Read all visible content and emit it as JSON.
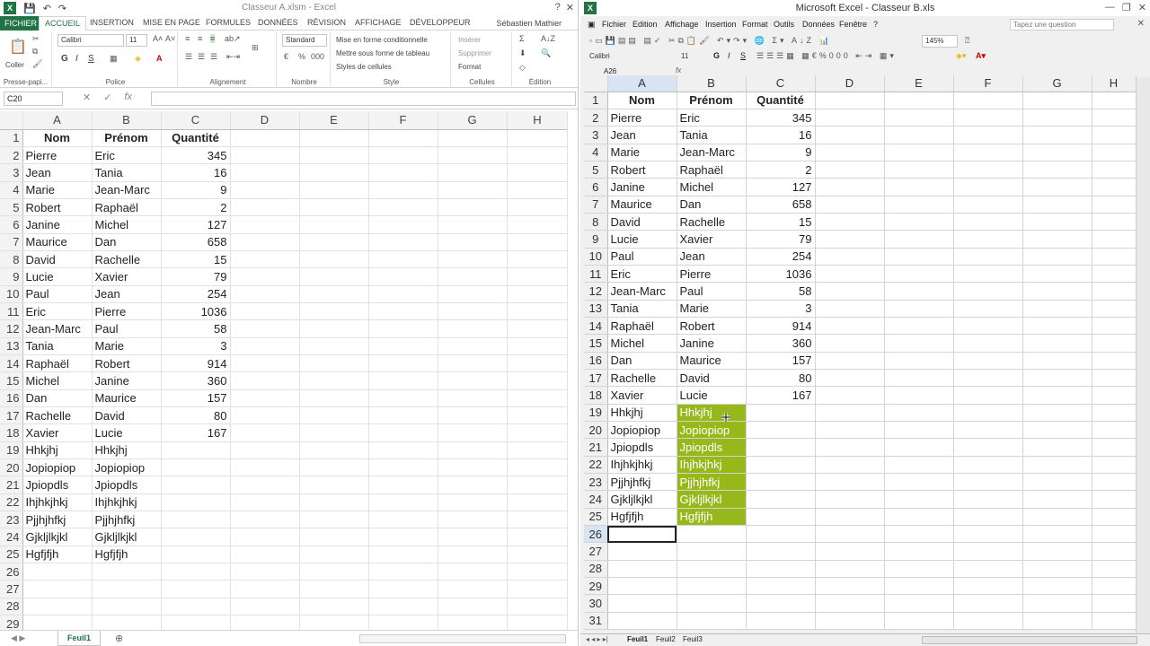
{
  "win_a": {
    "title": "Classeur A.xlsm - Excel",
    "user": "Sébastien Mathier",
    "tabs": [
      "FICHIER",
      "ACCUEIL",
      "INSERTION",
      "MISE EN PAGE",
      "FORMULES",
      "DONNÉES",
      "RÉVISION",
      "AFFICHAGE",
      "DÉVELOPPEUR"
    ],
    "ribbon": {
      "paste_label": "Coller",
      "clipboard": "Presse-papi...",
      "font_name": "Calibri",
      "font_size": "11",
      "bold": "G",
      "italic": "I",
      "underline": "S",
      "police": "Police",
      "alignement": "Alignement",
      "number_format": "Standard",
      "nombre": "Nombre",
      "cond_format": "Mise en forme conditionnelle",
      "table_format": "Mettre sous forme de tableau",
      "cell_styles": "Styles de cellules",
      "style": "Style",
      "insert": "Insérer",
      "delete": "Supprimer",
      "format": "Format",
      "cellules": "Cellules",
      "edition": "Édition"
    },
    "name_box": "C20",
    "fx": "fx",
    "columns": [
      "A",
      "B",
      "C",
      "D",
      "E",
      "F",
      "G",
      "H"
    ],
    "sheet_tab": "Feuil1"
  },
  "win_b": {
    "title": "Microsoft Excel - Classeur B.xls",
    "menu": [
      "Fichier",
      "Edition",
      "Affichage",
      "Insertion",
      "Format",
      "Outils",
      "Données",
      "Fenêtre",
      "?"
    ],
    "ask_placeholder": "Tapez une question",
    "zoom": "145%",
    "font_name": "Calibri",
    "font_size": "11",
    "bold": "G",
    "italic": "I",
    "underline": "S",
    "name_box": "A26",
    "fx": "fx",
    "columns": [
      "A",
      "B",
      "C",
      "D",
      "E",
      "F",
      "G",
      "H"
    ],
    "sheet_tabs": [
      "Feuil1",
      "Feuil2",
      "Feuil3"
    ]
  },
  "rows_a": [
    [
      "Nom",
      "Prénom",
      "Quantité"
    ],
    [
      "Pierre",
      "Eric",
      "345"
    ],
    [
      "Jean",
      "Tania",
      "16"
    ],
    [
      "Marie",
      "Jean-Marc",
      "9"
    ],
    [
      "Robert",
      "Raphaël",
      "2"
    ],
    [
      "Janine",
      "Michel",
      "127"
    ],
    [
      "Maurice",
      "Dan",
      "658"
    ],
    [
      "David",
      "Rachelle",
      "15"
    ],
    [
      "Lucie",
      "Xavier",
      "79"
    ],
    [
      "Paul",
      "Jean",
      "254"
    ],
    [
      "Eric",
      "Pierre",
      "1036"
    ],
    [
      "Jean-Marc",
      "Paul",
      "58"
    ],
    [
      "Tania",
      "Marie",
      "3"
    ],
    [
      "Raphaël",
      "Robert",
      "914"
    ],
    [
      "Michel",
      "Janine",
      "360"
    ],
    [
      "Dan",
      "Maurice",
      "157"
    ],
    [
      "Rachelle",
      "David",
      "80"
    ],
    [
      "Xavier",
      "Lucie",
      "167"
    ],
    [
      "Hhkjhj",
      "Hhkjhj",
      ""
    ],
    [
      "Jopiopiop",
      "Jopiopiop",
      ""
    ],
    [
      "Jpiopdls",
      "Jpiopdls",
      ""
    ],
    [
      "Ihjhkjhkj",
      "Ihjhkjhkj",
      ""
    ],
    [
      "Pjjhjhfkj",
      "Pjjhjhfkj",
      ""
    ],
    [
      "Gjkljlkjkl",
      "Gjkljlkjkl",
      ""
    ],
    [
      "Hgfjfjh",
      "Hgfjfjh",
      ""
    ],
    [
      "",
      "",
      ""
    ],
    [
      "",
      "",
      ""
    ],
    [
      "",
      "",
      ""
    ],
    [
      "",
      "",
      ""
    ]
  ],
  "rows_b": [
    [
      "Nom",
      "Prénom",
      "Quantité"
    ],
    [
      "Pierre",
      "Eric",
      "345"
    ],
    [
      "Jean",
      "Tania",
      "16"
    ],
    [
      "Marie",
      "Jean-Marc",
      "9"
    ],
    [
      "Robert",
      "Raphaël",
      "2"
    ],
    [
      "Janine",
      "Michel",
      "127"
    ],
    [
      "Maurice",
      "Dan",
      "658"
    ],
    [
      "David",
      "Rachelle",
      "15"
    ],
    [
      "Lucie",
      "Xavier",
      "79"
    ],
    [
      "Paul",
      "Jean",
      "254"
    ],
    [
      "Eric",
      "Pierre",
      "1036"
    ],
    [
      "Jean-Marc",
      "Paul",
      "58"
    ],
    [
      "Tania",
      "Marie",
      "3"
    ],
    [
      "Raphaël",
      "Robert",
      "914"
    ],
    [
      "Michel",
      "Janine",
      "360"
    ],
    [
      "Dan",
      "Maurice",
      "157"
    ],
    [
      "Rachelle",
      "David",
      "80"
    ],
    [
      "Xavier",
      "Lucie",
      "167"
    ],
    [
      "Hhkjhj",
      "Hhkjhj",
      ""
    ],
    [
      "Jopiopiop",
      "Jopiopiop",
      ""
    ],
    [
      "Jpiopdls",
      "Jpiopdls",
      ""
    ],
    [
      "Ihjhkjhkj",
      "Ihjhkjhkj",
      ""
    ],
    [
      "Pjjhjhfkj",
      "Pjjhjhfkj",
      ""
    ],
    [
      "Gjkljlkjkl",
      "Gjkljlkjkl",
      ""
    ],
    [
      "Hgfjfjh",
      "Hgfjfjh",
      ""
    ],
    [
      "",
      "",
      ""
    ],
    [
      "",
      "",
      ""
    ],
    [
      "",
      "",
      ""
    ],
    [
      "",
      "",
      ""
    ],
    [
      "",
      "",
      ""
    ],
    [
      "",
      "",
      ""
    ]
  ],
  "colors": {
    "excel_green": "#217346",
    "highlight": "#97b81a"
  }
}
